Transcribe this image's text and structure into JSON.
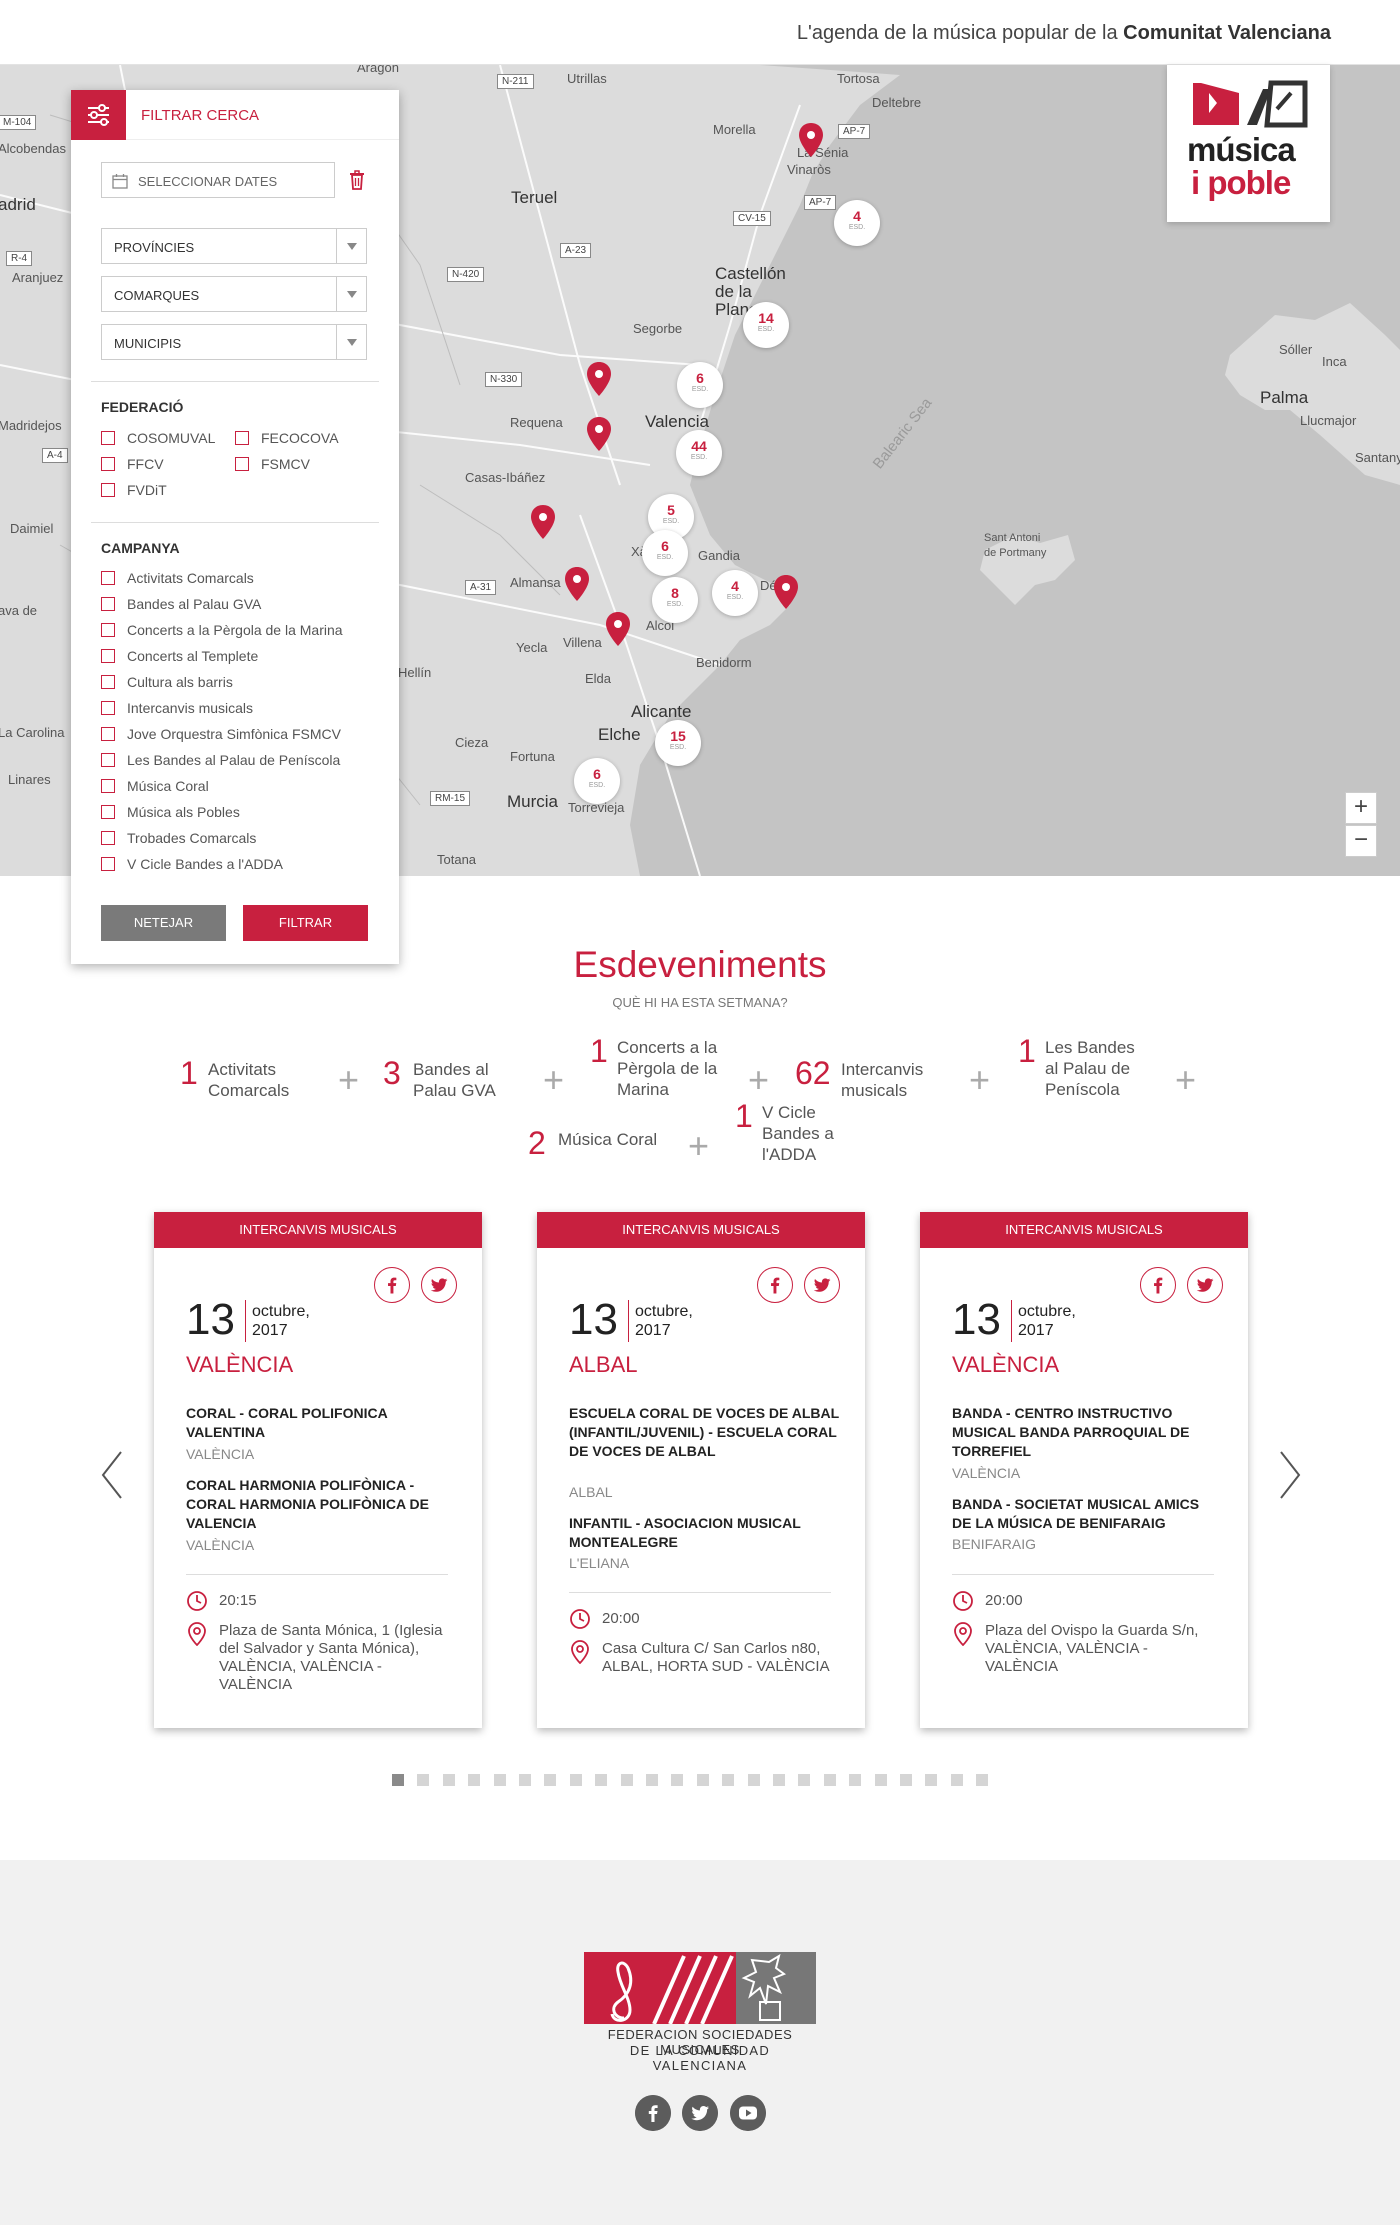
{
  "header": {
    "tagline_prefix": "L'agenda de la música popular de la ",
    "tagline_bold": "Comunitat Valenciana"
  },
  "logo": {
    "line1": "música",
    "line2": "i poble"
  },
  "map": {
    "labels": [
      "Aragón",
      "Utrillas",
      "Morella",
      "Tortosa",
      "Deltebre",
      "La Sénia",
      "Vinaròs",
      "Teruel",
      "Castellón de la Plana",
      "Segorbe",
      "Alcobendas",
      "adrid",
      "Aranjuez",
      "Requena",
      "Valencia",
      "Casas-Ibáñez",
      "Madridejos",
      "Daimiel",
      "Almansa",
      "Xàtiva",
      "Gandia",
      "Dénia",
      "Villena",
      "Alcoi",
      "Yecla",
      "Benidorm",
      "Hellín",
      "Elda",
      "Alicante",
      "Elche",
      "Cieza",
      "La Carolina",
      "Linares",
      "Fortuna",
      "Murcia",
      "Torrevieja",
      "Totana",
      "Sóller",
      "Inca",
      "Palma",
      "Llucmajor",
      "Santanyí",
      "Sant Antoni de Portmany",
      "Balearic Sea",
      "ava de",
      "Vinaròs"
    ],
    "roads": [
      "N-211",
      "AP-7",
      "AP-7",
      "CV-15",
      "A-23",
      "N-420",
      "N-330",
      "A-31",
      "RM-15",
      "A-4",
      "R-4",
      "M-104"
    ],
    "clusters": [
      {
        "n": "4",
        "u": "ESD."
      },
      {
        "n": "14",
        "u": "ESD."
      },
      {
        "n": "6",
        "u": "ESD."
      },
      {
        "n": "44",
        "u": "ESD."
      },
      {
        "n": "5",
        "u": "ESD."
      },
      {
        "n": "6",
        "u": "ESD."
      },
      {
        "n": "8",
        "u": "ESD."
      },
      {
        "n": "4",
        "u": "ESD."
      },
      {
        "n": "15",
        "u": "ESD."
      },
      {
        "n": "6",
        "u": "ESD."
      }
    ],
    "zoom_in": "+",
    "zoom_out": "−"
  },
  "filter": {
    "title": "FILTRAR CERCA",
    "date_placeholder": "SELECCIONAR DATES",
    "selects": [
      "PROVÍNCIES",
      "COMARQUES",
      "MUNICIPIS"
    ],
    "federacio_title": "FEDERACIÓ",
    "federacio": [
      "COSOMUVAL",
      "FECOCOVA",
      "FFCV",
      "FSMCV",
      "FVDiT"
    ],
    "campanya_title": "CAMPANYA",
    "campanya": [
      "Activitats Comarcals",
      "Bandes al Palau GVA",
      "Concerts a la Pèrgola de la Marina",
      "Concerts al Templete",
      "Cultura als barris",
      "Intercanvis musicals",
      "Jove Orquestra Simfònica FSMCV",
      "Les Bandes al Palau de Peníscola",
      "Música Coral",
      "Música als Pobles",
      "Trobades Comarcals",
      "V Cicle Bandes a l'ADDA"
    ],
    "btn_clear": "NETEJAR",
    "btn_filter": "FILTRAR"
  },
  "events": {
    "title": "Esdeveniments",
    "subtitle": "QUÈ HI HA ESTA SETMANA?",
    "summary": [
      {
        "num": "1",
        "label": "Activitats Comarcals"
      },
      {
        "num": "3",
        "label": "Bandes al Palau GVA"
      },
      {
        "num": "1",
        "label": "Concerts a la Pèrgola de la Marina"
      },
      {
        "num": "62",
        "label": "Intercanvis musicals"
      },
      {
        "num": "1",
        "label": "Les Bandes al Palau de Peníscola"
      },
      {
        "num": "2",
        "label": "Música Coral"
      },
      {
        "num": "1",
        "label": "V Cicle Bandes a l'ADDA"
      }
    ],
    "plus": "+"
  },
  "cards": [
    {
      "category": "INTERCANVIS MUSICALS",
      "day": "13",
      "month": "octubre,",
      "year": "2017",
      "city": "VALÈNCIA",
      "items": [
        {
          "name": "CORAL - CORAL POLIFONICA VALENTINA",
          "loc": "VALÈNCIA"
        },
        {
          "name": "CORAL HARMONIA POLIFÒNICA - CORAL HARMONIA POLIFÒNICA DE VALENCIA",
          "loc": "VALÈNCIA"
        }
      ],
      "time": "20:15",
      "address": "Plaza de Santa Mónica, 1 (Iglesia del Salvador y Santa Mónica), VALÈNCIA, VALÈNCIA - VALÈNCIA"
    },
    {
      "category": "INTERCANVIS MUSICALS",
      "day": "13",
      "month": "octubre,",
      "year": "2017",
      "city": "ALBAL",
      "items": [
        {
          "name": "ESCUELA CORAL DE VOCES DE ALBAL (INFANTIL/JUVENIL) - ESCUELA CORAL DE VOCES DE ALBAL",
          "loc": "ALBAL"
        },
        {
          "name": "INFANTIL - ASOCIACION MUSICAL MONTEALEGRE",
          "loc": "L'ELIANA"
        }
      ],
      "time": "20:00",
      "address": "Casa Cultura C/ San Carlos n80, ALBAL, HORTA SUD - VALÈNCIA"
    },
    {
      "category": "INTERCANVIS MUSICALS",
      "day": "13",
      "month": "octubre,",
      "year": "2017",
      "city": "VALÈNCIA",
      "items": [
        {
          "name": "Banda - CENTRO INSTRUCTIVO MUSICAL BANDA PARROQUIAL DE TORREFIEL",
          "loc": "VALÈNCIA"
        },
        {
          "name": "Banda - SOCIETAT MUSICAL AMICS DE LA MÚSICA DE BENIFARAIG",
          "loc": "BENIFARAIG"
        }
      ],
      "time": "20:00",
      "address": "Plaza del Ovispo la Guarda S/n, VALÈNCIA, VALÈNCIA - VALÈNCIA"
    }
  ],
  "footer": {
    "org_line1": "FEDERACION SOCIEDADES MUSICALES",
    "org_line2": "DE LA COMUNIDAD VALENCIANA"
  },
  "colors": {
    "accent": "#c8203f",
    "map_land": "#dcdcdc",
    "map_sea": "#c4c4c4",
    "footer_bg": "#f1f1f1"
  }
}
